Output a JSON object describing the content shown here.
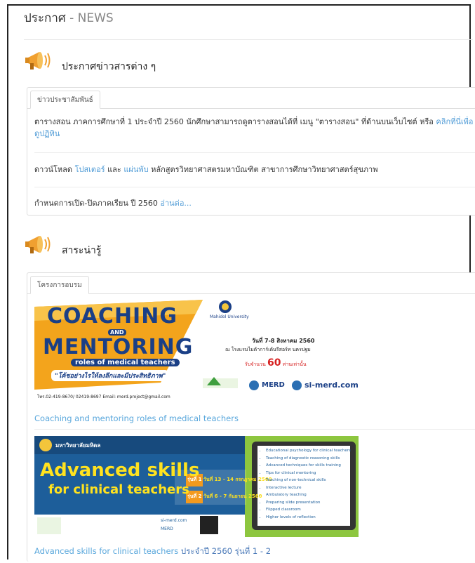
{
  "header": {
    "title_th": "ประกาศ",
    "title_sep": " - ",
    "title_en": "NEWS"
  },
  "announcements": {
    "section_title": "ประกาศข่าวสารต่าง ๆ",
    "tab_label": "ข่าวประชาสัมพันธ์",
    "items": [
      {
        "text": "ตารางสอน ภาคการศึกษาที่ 1 ประจำปี 2560 นักศึกษาสามารถดูตารางสอนได้ที่ เมนู \"ตารางสอน\" ที่ด้านบนเว็บไซต์ หรือ ",
        "link": "คลิกที่นี่เพื่อดูปฏิทิน"
      },
      {
        "prefix": "ดาวน์โหลด ",
        "link1": "โปสเตอร์",
        "mid": " และ ",
        "link2": "แผ่นพับ",
        "suffix": " หลักสูตรวิทยาศาสตรมหาบัณฑิต สาขาการศึกษาวิทยาศาสตร์สุขภาพ"
      },
      {
        "text": "กำหนดการเปิด-ปิดภาคเรียน ปี 2560 ",
        "link": "อ่านต่อ..."
      }
    ]
  },
  "interesting": {
    "section_title": "สาระน่ารู้",
    "tab_label": "โครงการอบรม",
    "banner1": {
      "title_top": "COACHING",
      "title_and": "AND",
      "title_bottom": "MENTORING",
      "subtitle": "roles of medical teachers",
      "tagline": "\"โค้ชอย่างไรให้ลงลึกและมีประสิทธิภาพ\"",
      "org": "Mahidol University",
      "date": "วันที่ 7-8 สิงหาคม 2560",
      "venue": "ณ โรงแรมไมด้าการ์เด้นรีสอร์ท นครปฐม",
      "limit": "รับจำนวน",
      "limit_num": "60",
      "limit_unit": "ท่านเท่านั้น",
      "contact": "โทร.02-419-8670/ 02419-8697 Email: merd.project@gmail.com",
      "merd": "MERD",
      "site": "si-merd.com"
    },
    "caption1": "Coaching and mentoring roles of medical teachers",
    "banner2": {
      "uni": "มหาวิทยาลัยมหิดล",
      "title1": "Advanced skills",
      "title2": "for clinical teachers",
      "round1": "รุ่นที่ 1",
      "round1_date": "วันที่ 13 - 14 กรกฎาคม 2560",
      "round2": "รุ่นที่ 2",
      "round2_date": "วันที่ 6 - 7 กันยายน 2560",
      "topics": [
        "Educational psychology for clinical teachers",
        "Teaching of diagnostic reasoning skills",
        "Advanced techniques for skills training",
        "Tips for clinical mentoring",
        "Teaching of non-technical skills",
        "Interactive lecture",
        "Ambulatory teaching",
        "Preparing slide presentation",
        "Flipped classroom",
        "Higher levels of reflection"
      ],
      "site": "si-merd.com",
      "merd": "MERD"
    },
    "caption2_en": "Advanced skills for clinical teachers ",
    "caption2_th": "ประจำปี 2560 รุ่นที่ 1 - 2"
  },
  "colors": {
    "link": "#4f9bd6",
    "coaching_orange": "#f3a41c",
    "coaching_blue": "#1a3f86",
    "adv_yellow": "#ffe21f",
    "adv_green": "#7dc242"
  }
}
